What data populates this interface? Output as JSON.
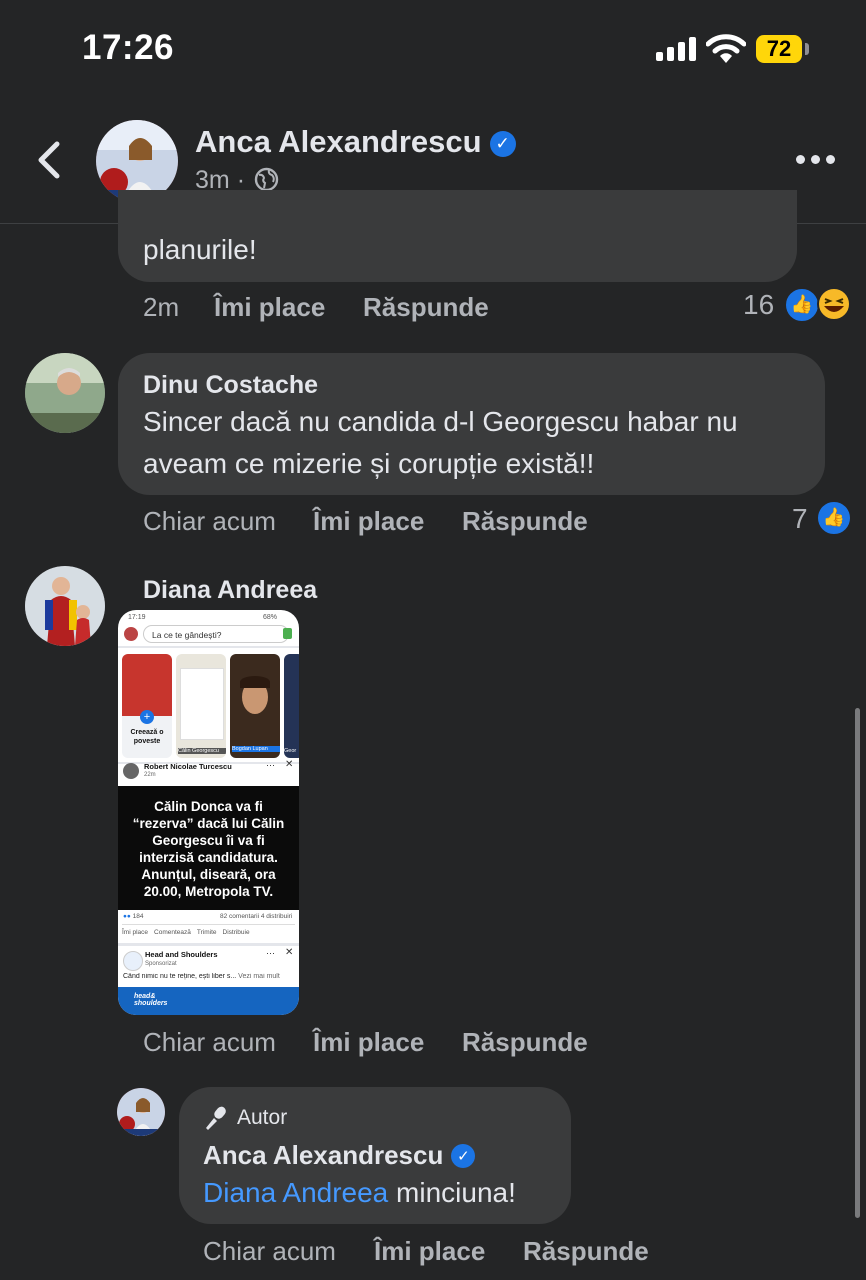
{
  "status_bar": {
    "time": "17:26",
    "battery": "72"
  },
  "header": {
    "name": "Anca Alexandrescu",
    "time": "3m",
    "dot": "·"
  },
  "comments": [
    {
      "text": "planurile!",
      "time": "2m",
      "like": "Îmi place",
      "reply": "Răspunde",
      "reactions_count": "16"
    },
    {
      "name": "Dinu Costache",
      "text_line1": "Sincer dacă nu candida d-l Georgescu habar nu",
      "text_line2": "aveam ce mizerie și corupție există!!",
      "time": "Chiar acum",
      "like": "Îmi place",
      "reply": "Răspunde",
      "reactions_count": "7"
    },
    {
      "name": "Diana Andreea",
      "time": "Chiar acum",
      "like": "Îmi place",
      "reply": "Răspunde",
      "screenshot": {
        "status_time": "17:19",
        "status_battery": "68%",
        "composer_placeholder": "La ce te gândești?",
        "story_create": "Creează o poveste",
        "story_label_2": "Călin Georgescu",
        "story_label_3": "Bogdan Lupan",
        "story_label_4": "Geor",
        "post_author": "Robert Nicolae Turcescu",
        "post_time": "22m",
        "post_text": "Călin Donca va fi “rezerva” dacă lui Călin Georgescu îi va fi interzisă candidatura. Anunțul, diseară, ora 20.00, Metropola TV.",
        "post_reactions": "184",
        "post_stats": "82 comentarii  4 distribuiri",
        "action_like": "Îmi place",
        "action_comment": "Comentează",
        "action_send": "Trimite",
        "action_share": "Distribuie",
        "ad_name": "Head and Shoulders",
        "ad_sponsored": "Sponsorizat",
        "ad_text": "Când nimic nu te reține, ești liber s...",
        "ad_more": "Vezi mai mult",
        "ad_logo": "head& shoulders"
      }
    }
  ],
  "reply": {
    "badge": "Autor",
    "name": "Anca Alexandrescu",
    "mention": "Diana Andreea",
    "text": " minciuna!",
    "time": "Chiar acum",
    "like": "Îmi place",
    "reply": "Răspunde"
  }
}
